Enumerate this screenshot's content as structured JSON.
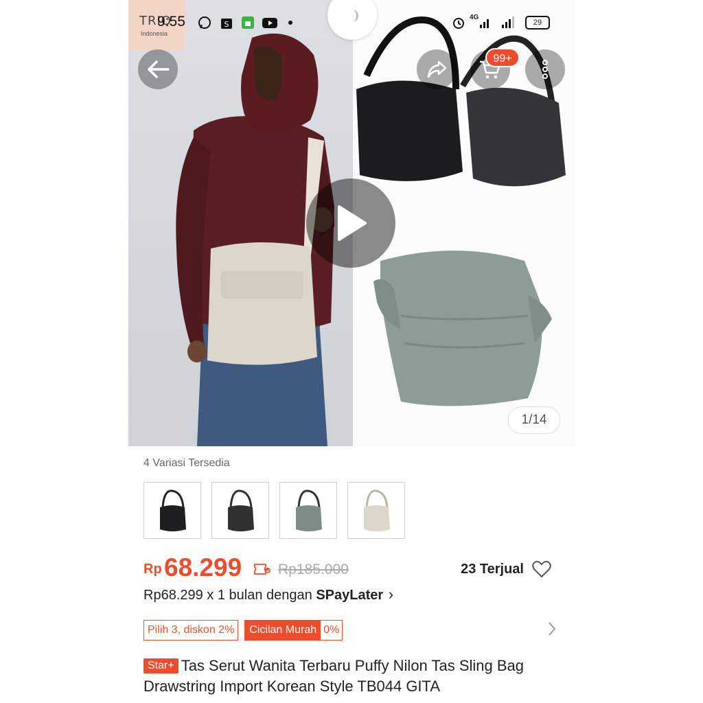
{
  "status_bar": {
    "time": "9:55",
    "battery": "29",
    "network": "4G"
  },
  "gallery": {
    "brand_name": "TRIO",
    "brand_sub": "Indonesia",
    "cart_badge": "99+",
    "counter": "1/14"
  },
  "variations": {
    "title": "4 Variasi Tersedia",
    "items": [
      {
        "color": "#1f1f22"
      },
      {
        "color": "#2f3230"
      },
      {
        "color": "#7d8c86"
      },
      {
        "color": "#dcd6cc"
      }
    ]
  },
  "price": {
    "currency": "Rp",
    "current": "68.299",
    "original": "Rp185.000",
    "sold": "23 Terjual",
    "accent_color": "#ee4d2d"
  },
  "paylater": {
    "prefix": "Rp68.299 x 1 bulan dengan ",
    "brand": "SPayLater",
    "arrow": "›"
  },
  "promos": {
    "discount": "Pilih 3, diskon 2%",
    "installment": "Cicilan Murah",
    "installment_rate": "0%"
  },
  "product": {
    "badge": "Star+",
    "title": "Tas Serut Wanita Terbaru Puffy Nilon Tas Sling Bag Drawstring Import Korean Style TB044 GITA"
  }
}
